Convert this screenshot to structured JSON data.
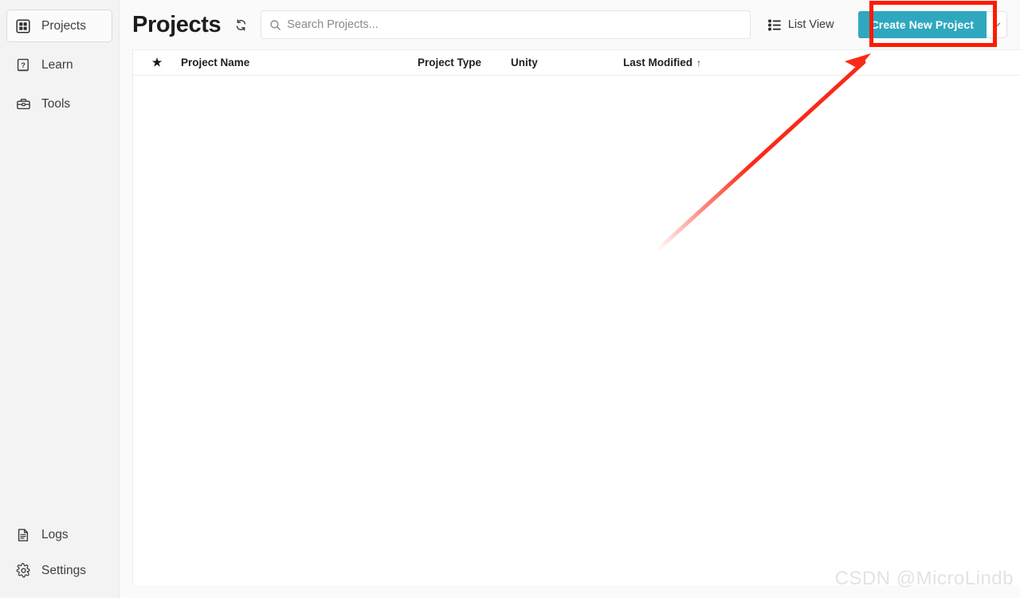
{
  "sidebar": {
    "top_items": [
      {
        "id": "projects",
        "label": "Projects",
        "icon": "grid-icon",
        "selected": true
      },
      {
        "id": "learn",
        "label": "Learn",
        "icon": "book-question-icon",
        "selected": false
      },
      {
        "id": "tools",
        "label": "Tools",
        "icon": "toolbox-icon",
        "selected": false
      }
    ],
    "bottom_items": [
      {
        "id": "logs",
        "label": "Logs",
        "icon": "document-lines-icon",
        "selected": false
      },
      {
        "id": "settings",
        "label": "Settings",
        "icon": "gear-icon",
        "selected": false
      }
    ]
  },
  "topbar": {
    "title": "Projects",
    "refresh_icon": "refresh-icon",
    "search": {
      "value": "",
      "placeholder": "Search Projects...",
      "icon": "search-icon"
    },
    "list_view": {
      "label": "List View",
      "icon": "list-view-icon"
    },
    "create_project": {
      "label": "Create New Project",
      "caret_icon": "chevron-down-icon",
      "accent_color": "#2fa8bf"
    }
  },
  "table": {
    "columns": [
      {
        "id": "favorite",
        "label": "★"
      },
      {
        "id": "project_name",
        "label": "Project Name"
      },
      {
        "id": "project_type",
        "label": "Project Type"
      },
      {
        "id": "unity",
        "label": "Unity"
      },
      {
        "id": "last_modified",
        "label": "Last Modified"
      }
    ],
    "sort": {
      "column": "Last Modified",
      "direction_icon": "↑"
    },
    "rows": []
  },
  "annotations": {
    "highlight_box": {
      "color": "#ff0000",
      "target": "create-new-project-button"
    },
    "arrow": {
      "color": "#fa2a18",
      "points_to": "create-new-project-button"
    }
  },
  "watermark": {
    "text": "CSDN @MicroLindb"
  }
}
